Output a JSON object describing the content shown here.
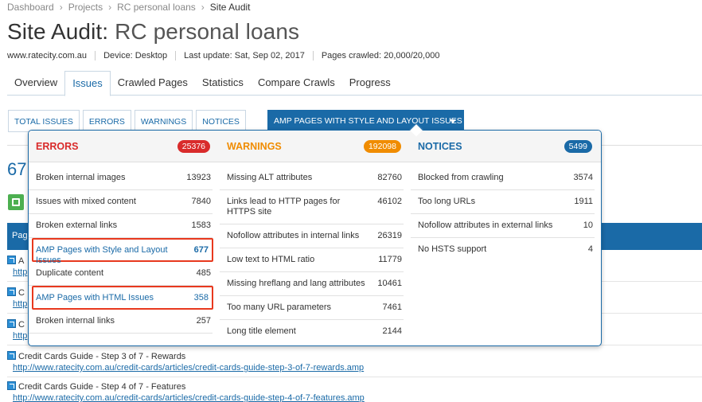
{
  "breadcrumb": [
    "Dashboard",
    "Projects",
    "RC personal loans",
    "Site Audit"
  ],
  "title": {
    "part1": "Site Audit:",
    "part2": "RC personal loans"
  },
  "meta": [
    "www.ratecity.com.au",
    "Device: Desktop",
    "Last update: Sat, Sep 02, 2017",
    "Pages crawled: 20,000/20,000"
  ],
  "tabs": [
    "Overview",
    "Issues",
    "Crawled Pages",
    "Statistics",
    "Compare Crawls",
    "Progress"
  ],
  "active_tab": "Issues",
  "filters": [
    "TOTAL ISSUES",
    "ERRORS",
    "WARNINGS",
    "NOTICES"
  ],
  "dropdown_label": "AMP PAGES WITH STYLE AND LAYOUT ISSUES",
  "background": {
    "big_number": "67",
    "bar_text": "Pag",
    "rows": [
      {
        "title": "Credit Cards Guide - Step 3 of 7 - Rewards",
        "url": "http://www.ratecity.com.au/credit-cards/articles/credit-cards-guide-step-3-of-7-rewards.amp"
      },
      {
        "title": "Credit Cards Guide - Step 4 of 7 - Features",
        "url": "http://www.ratecity.com.au/credit-cards/articles/credit-cards-guide-step-4-of-7-features.amp"
      }
    ],
    "partial_rows": [
      {
        "title": "A",
        "url": "http"
      },
      {
        "title": "C",
        "url": "http"
      },
      {
        "title": "C",
        "url": "http"
      }
    ]
  },
  "errors": {
    "label": "ERRORS",
    "count": "25376",
    "items": [
      {
        "label": "Broken internal images",
        "value": "13923"
      },
      {
        "label": "Issues with mixed content",
        "value": "7840"
      },
      {
        "label": "Broken external links",
        "value": "1583"
      },
      {
        "label": "AMP Pages with Style and Layout Issues",
        "value": "677"
      },
      {
        "label": "Duplicate content",
        "value": "485"
      },
      {
        "label": "AMP Pages with HTML Issues",
        "value": "358"
      },
      {
        "label": "Broken internal links",
        "value": "257"
      }
    ]
  },
  "warnings": {
    "label": "WARNINGS",
    "count": "192098",
    "items": [
      {
        "label": "Missing ALT attributes",
        "value": "82760"
      },
      {
        "label": "Links lead to HTTP pages for HTTPS site",
        "value": "46102"
      },
      {
        "label": "Nofollow attributes in internal links",
        "value": "26319"
      },
      {
        "label": "Low text to HTML ratio",
        "value": "11779"
      },
      {
        "label": "Missing hreflang and lang attributes",
        "value": "10461"
      },
      {
        "label": "Too many URL parameters",
        "value": "7461"
      },
      {
        "label": "Long title element",
        "value": "2144"
      }
    ]
  },
  "notices": {
    "label": "NOTICES",
    "count": "5499",
    "items": [
      {
        "label": "Blocked from crawling",
        "value": "3574"
      },
      {
        "label": "Too long URLs",
        "value": "1911"
      },
      {
        "label": "Nofollow attributes in external links",
        "value": "10"
      },
      {
        "label": "No HSTS support",
        "value": "4"
      }
    ]
  },
  "colors": {
    "accent": "#1a6aa7",
    "error": "#d92b2b",
    "warning": "#f08c00",
    "highlight": "#e8391e"
  }
}
